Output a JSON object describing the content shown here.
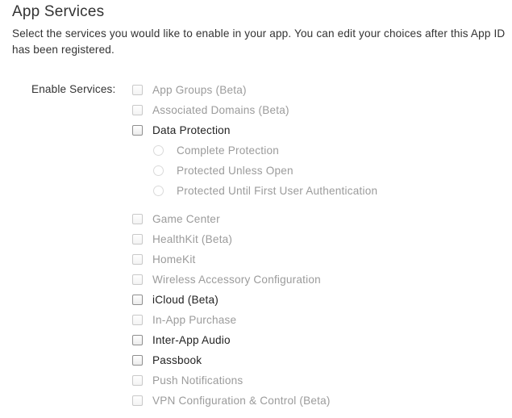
{
  "header": {
    "title": "App Services",
    "description": "Select the services you would like to enable in your app. You can edit your choices after this App ID has been registered."
  },
  "form": {
    "enable_label": "Enable Services:",
    "services": [
      {
        "label": "App Groups (Beta)",
        "enabled": false,
        "checked": false
      },
      {
        "label": "Associated Domains (Beta)",
        "enabled": false,
        "checked": false
      },
      {
        "label": "Data Protection",
        "enabled": true,
        "checked": false
      },
      {
        "label": "Game Center",
        "enabled": false,
        "checked": false
      },
      {
        "label": "HealthKit (Beta)",
        "enabled": false,
        "checked": false
      },
      {
        "label": "HomeKit",
        "enabled": false,
        "checked": false
      },
      {
        "label": "Wireless Accessory Configuration",
        "enabled": false,
        "checked": false
      },
      {
        "label": "iCloud (Beta)",
        "enabled": true,
        "checked": false
      },
      {
        "label": "In-App Purchase",
        "enabled": false,
        "checked": false
      },
      {
        "label": "Inter-App Audio",
        "enabled": true,
        "checked": false
      },
      {
        "label": "Passbook",
        "enabled": true,
        "checked": false
      },
      {
        "label": "Push Notifications",
        "enabled": false,
        "checked": false
      },
      {
        "label": "VPN Configuration & Control (Beta)",
        "enabled": false,
        "checked": false
      }
    ],
    "data_protection_options": [
      {
        "label": "Complete Protection",
        "enabled": false,
        "selected": false
      },
      {
        "label": "Protected Unless Open",
        "enabled": false,
        "selected": false
      },
      {
        "label": "Protected Until First User Authentication",
        "enabled": false,
        "selected": false
      }
    ]
  }
}
